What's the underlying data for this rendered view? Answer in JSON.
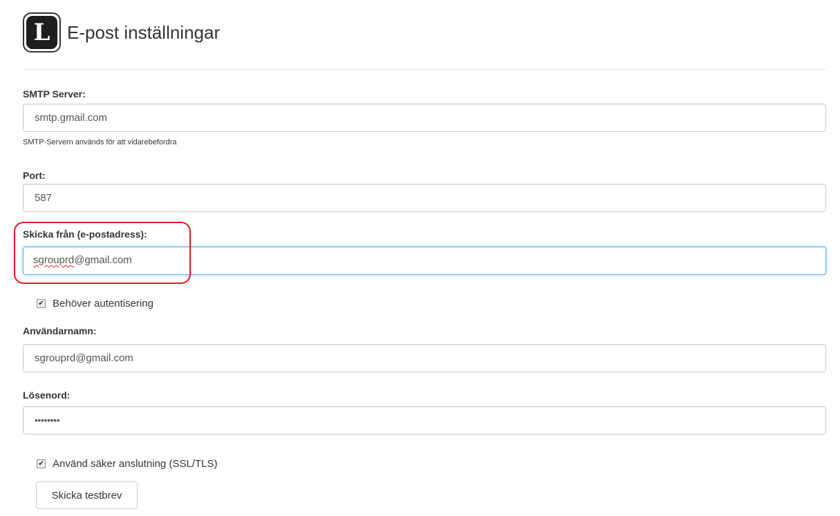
{
  "header": {
    "logo_letter": "L",
    "title": "E-post inställningar"
  },
  "form": {
    "smtp_server": {
      "label": "SMTP Server:",
      "value": "smtp.gmail.com",
      "help": "SMTP-Servern används för att vidarebefordra"
    },
    "port": {
      "label": "Port:",
      "value": "587"
    },
    "send_from": {
      "label": "Skicka från (e-postadress):",
      "value": "sgrouprd@gmail.com",
      "value_underlined": "sgrouprd",
      "value_rest": "@gmail.com",
      "focused": true,
      "highlighted": true
    },
    "requires_auth": {
      "label": "Behöver autentisering",
      "checked": true
    },
    "username": {
      "label": "Användarnamn:",
      "value": "sgrouprd@gmail.com"
    },
    "password": {
      "label": "Lösenord:",
      "value": "••••••••"
    },
    "use_ssl": {
      "label": "Använd säker anslutning (SSL/TLS)",
      "checked": true
    },
    "test_button": {
      "label": "Skicka testbrev"
    }
  },
  "colors": {
    "highlight": "#e0191b",
    "focus_border": "#66afe9",
    "input_border": "#cccccc",
    "text": "#333333"
  },
  "icons": {
    "logo": "l-logo-icon",
    "checkbox_checked": "checkmark-icon"
  }
}
